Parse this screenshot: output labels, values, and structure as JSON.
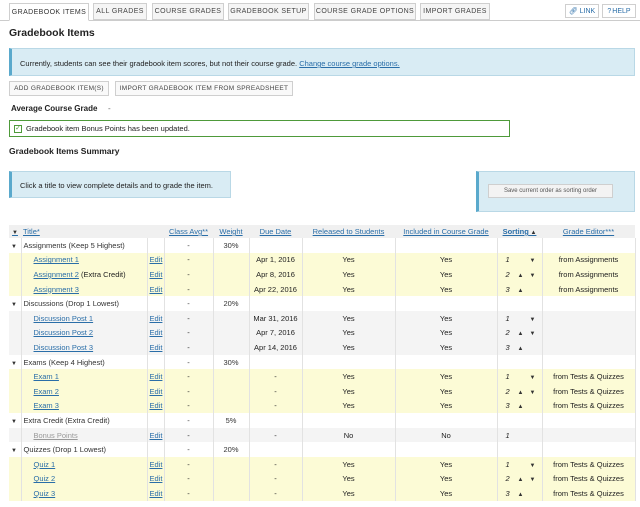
{
  "tabs": [
    {
      "label": "GRADEBOOK ITEMS",
      "active": true
    },
    {
      "label": "ALL GRADES"
    },
    {
      "label": "COURSE GRADES"
    },
    {
      "label": "GRADEBOOK SETUP"
    },
    {
      "label": "COURSE GRADE OPTIONS"
    },
    {
      "label": "IMPORT GRADES"
    }
  ],
  "header_links": {
    "link": "LINK",
    "help": "HELP"
  },
  "page_title": "Gradebook Items",
  "notice": {
    "text": "Currently, students can see their gradebook item scores, but not their course grade.",
    "link": "Change course grade options."
  },
  "actions": {
    "add": "ADD GRADEBOOK ITEM(S)",
    "import": "IMPORT GRADEBOOK ITEM FROM SPREADSHEET"
  },
  "average": {
    "label": "Average Course Grade",
    "value": "-"
  },
  "success_message": "Gradebook item Bonus Points has been updated.",
  "summary_title": "Gradebook Items Summary",
  "hint": "Click a title to view complete details and to grade the item.",
  "save_order_label": "Save current order as sorting order",
  "columns": [
    "Title*",
    "Class Avg**",
    "Weight",
    "Due Date",
    "Released to Students",
    "Included in Course Grade",
    "Sorting",
    "Grade Editor***"
  ],
  "edit_label": "Edit",
  "rows": [
    {
      "kind": "cat",
      "title": "Assignments (Keep 5 Highest)",
      "avg": "-",
      "weight": "30%"
    },
    {
      "kind": "item",
      "bg": "y",
      "title": "Assignment 1",
      "avg": "-",
      "due": "Apr 1, 2016",
      "released": "Yes",
      "included": "Yes",
      "sort": "1",
      "up": false,
      "down": true,
      "editor": "from Assignments"
    },
    {
      "kind": "item",
      "bg": "y",
      "title": "Assignment 2",
      "extra": " (Extra Credit)",
      "avg": "-",
      "due": "Apr 8, 2016",
      "released": "Yes",
      "included": "Yes",
      "sort": "2",
      "up": true,
      "down": true,
      "editor": "from Assignments"
    },
    {
      "kind": "item",
      "bg": "y",
      "title": "Assignment 3",
      "avg": "-",
      "due": "Apr 22, 2016",
      "released": "Yes",
      "included": "Yes",
      "sort": "3",
      "up": true,
      "down": false,
      "editor": "from Assignments"
    },
    {
      "kind": "cat",
      "title": "Discussions (Drop 1 Lowest)",
      "avg": "-",
      "weight": "20%"
    },
    {
      "kind": "item",
      "bg": "g",
      "title": "Discussion Post 1",
      "avg": "-",
      "due": "Mar 31, 2016",
      "released": "Yes",
      "included": "Yes",
      "sort": "1",
      "up": false,
      "down": true,
      "editor": ""
    },
    {
      "kind": "item",
      "bg": "g",
      "title": "Discussion Post 2",
      "avg": "-",
      "due": "Apr 7, 2016",
      "released": "Yes",
      "included": "Yes",
      "sort": "2",
      "up": true,
      "down": true,
      "editor": ""
    },
    {
      "kind": "item",
      "bg": "g",
      "title": "Discussion Post 3",
      "avg": "-",
      "due": "Apr 14, 2016",
      "released": "Yes",
      "included": "Yes",
      "sort": "3",
      "up": true,
      "down": false,
      "editor": ""
    },
    {
      "kind": "cat",
      "title": "Exams (Keep 4 Highest)",
      "avg": "-",
      "weight": "30%"
    },
    {
      "kind": "item",
      "bg": "y",
      "title": "Exam 1",
      "avg": "-",
      "due": "-",
      "released": "Yes",
      "included": "Yes",
      "sort": "1",
      "up": false,
      "down": true,
      "editor": "from Tests & Quizzes"
    },
    {
      "kind": "item",
      "bg": "y",
      "title": "Exam 2",
      "avg": "-",
      "due": "-",
      "released": "Yes",
      "included": "Yes",
      "sort": "2",
      "up": true,
      "down": true,
      "editor": "from Tests & Quizzes"
    },
    {
      "kind": "item",
      "bg": "y",
      "title": "Exam 3",
      "avg": "-",
      "due": "-",
      "released": "Yes",
      "included": "Yes",
      "sort": "3",
      "up": true,
      "down": false,
      "editor": "from Tests & Quizzes"
    },
    {
      "kind": "cat",
      "title": "Extra Credit (Extra Credit)",
      "avg": "-",
      "weight": "5%"
    },
    {
      "kind": "item",
      "bg": "g",
      "title": "Bonus Points",
      "muted": true,
      "avg": "-",
      "due": "-",
      "released": "No",
      "included": "No",
      "sort": "1",
      "up": false,
      "down": false,
      "editor": ""
    },
    {
      "kind": "cat",
      "title": "Quizzes (Drop 1 Lowest)",
      "avg": "-",
      "weight": "20%"
    },
    {
      "kind": "item",
      "bg": "y",
      "title": "Quiz 1",
      "avg": "-",
      "due": "-",
      "released": "Yes",
      "included": "Yes",
      "sort": "1",
      "up": false,
      "down": true,
      "editor": "from Tests & Quizzes"
    },
    {
      "kind": "item",
      "bg": "y",
      "title": "Quiz 2",
      "avg": "-",
      "due": "-",
      "released": "Yes",
      "included": "Yes",
      "sort": "2",
      "up": true,
      "down": true,
      "editor": "from Tests & Quizzes"
    },
    {
      "kind": "item",
      "bg": "y",
      "title": "Quiz 3",
      "avg": "-",
      "due": "-",
      "released": "Yes",
      "included": "Yes",
      "sort": "3",
      "up": true,
      "down": false,
      "editor": "from Tests & Quizzes"
    }
  ]
}
